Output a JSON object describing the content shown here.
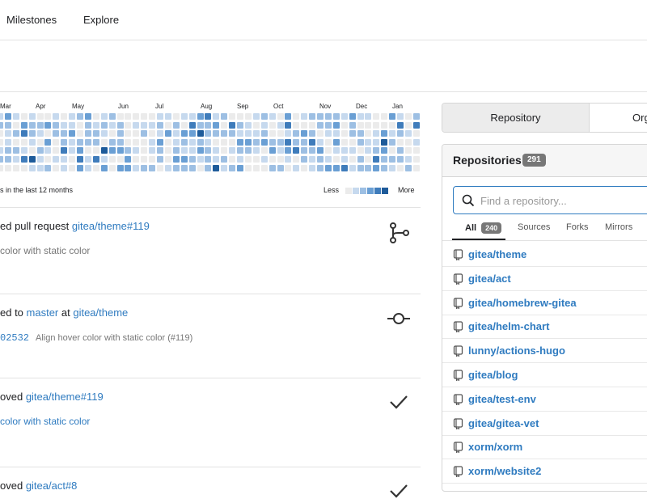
{
  "topnav": {
    "items": [
      "Milestones",
      "Explore"
    ]
  },
  "heatmap": {
    "months": [
      "Mar",
      "Apr",
      "May",
      "Jun",
      "Jul",
      "Aug",
      "Sep",
      "Oct",
      "Nov",
      "Dec",
      "Jan"
    ],
    "caption": "s in the last 12 months",
    "legend_less": "Less",
    "legend_more": "More",
    "colors": [
      "#ebebeb",
      "#c6d9ee",
      "#9dbfe3",
      "#6a9fd4",
      "#3f7cbb",
      "#1e5b9a"
    ]
  },
  "feed": {
    "items": [
      {
        "title_prefix": "ed pull request ",
        "link": "gitea/theme#119",
        "sub": "color with static color",
        "icon": "git-pull-request-icon"
      },
      {
        "title_prefix": "ed to ",
        "link": "master",
        "title_mid": " at ",
        "link2": "gitea/theme",
        "sha": "02532",
        "msg": "Align hover color with static color (#119)",
        "icon": "git-commit-icon"
      },
      {
        "title_prefix": "oved ",
        "link": "gitea/theme#119",
        "sub": "color with static color",
        "icon": "check-icon"
      },
      {
        "title_prefix": "oved ",
        "link": "gitea/act#8",
        "icon": "check-icon"
      }
    ]
  },
  "right_tabs": {
    "active": "Repository",
    "other": "Org"
  },
  "repos": {
    "title": "Repositories",
    "count": "291",
    "search_placeholder": "Find a repository...",
    "filters": [
      {
        "label": "All",
        "count": "240"
      },
      {
        "label": "Sources"
      },
      {
        "label": "Forks"
      },
      {
        "label": "Mirrors"
      }
    ],
    "list": [
      "gitea/theme",
      "gitea/act",
      "gitea/homebrew-gitea",
      "gitea/helm-chart",
      "lunny/actions-hugo",
      "gitea/blog",
      "gitea/test-env",
      "gitea/gitea-vet",
      "xorm/xorm",
      "xorm/website2"
    ]
  }
}
